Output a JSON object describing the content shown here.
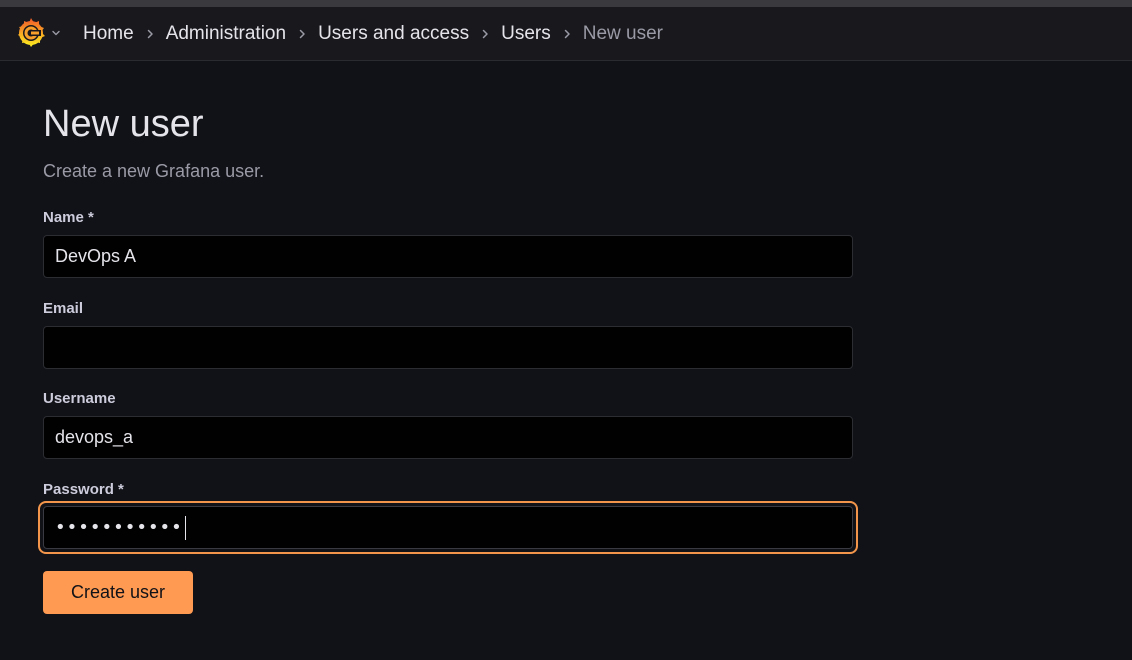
{
  "breadcrumb": {
    "items": [
      "Home",
      "Administration",
      "Users and access",
      "Users",
      "New user"
    ]
  },
  "page": {
    "title": "New user",
    "subtitle": "Create a new Grafana user."
  },
  "form": {
    "name": {
      "label": "Name *",
      "value": "DevOps A"
    },
    "email": {
      "label": "Email",
      "value": ""
    },
    "username": {
      "label": "Username",
      "value": "devops_a"
    },
    "password": {
      "label": "Password *",
      "masked_value": "•••••••••••"
    },
    "submit_label": "Create user"
  },
  "icons": {
    "logo": "grafana-logo-icon",
    "menu": "chevron-down-icon",
    "separator": "chevron-right-icon"
  },
  "colors": {
    "accent": "#ff9a52",
    "focus_ring": "#f3964c",
    "background": "#111217",
    "topbar": "#18181d"
  }
}
